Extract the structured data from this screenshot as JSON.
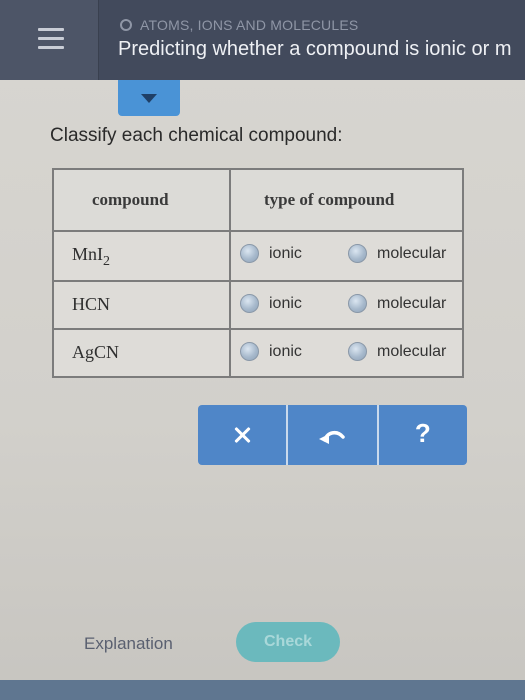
{
  "header": {
    "topic": "ATOMS, IONS AND MOLECULES",
    "title": "Predicting whether a compound is ionic or m"
  },
  "question": "Classify each chemical compound:",
  "table": {
    "columns": [
      "compound",
      "type of compound"
    ],
    "rows": [
      {
        "compound": "MnI",
        "subscript": "2"
      },
      {
        "compound": "HCN",
        "subscript": ""
      },
      {
        "compound": "AgCN",
        "subscript": ""
      }
    ],
    "options": [
      "ionic",
      "molecular"
    ]
  },
  "actions": {
    "help_label": "?"
  },
  "footer": {
    "explanation_label": "Explanation",
    "check_label": "Check"
  },
  "colors": {
    "header_bg": "#424a5c",
    "accent_blue": "#4f86c8",
    "check_teal": "#6bb9bd"
  },
  "icons": [
    "menu-icon",
    "topic-circle-icon",
    "chevron-down-icon",
    "close-icon",
    "undo-icon",
    "help-icon"
  ]
}
